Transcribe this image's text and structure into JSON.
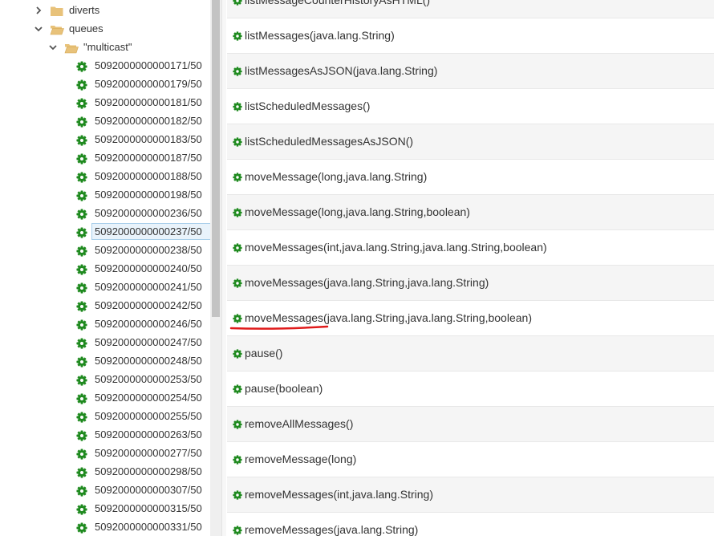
{
  "tree": {
    "folders": [
      {
        "label": "diverts",
        "expanded": false
      },
      {
        "label": "queues",
        "expanded": true
      },
      {
        "label": "\"multicast\"",
        "expanded": true
      }
    ],
    "queue_items": [
      "5092000000000171/50",
      "5092000000000179/50",
      "5092000000000181/50",
      "5092000000000182/50",
      "5092000000000183/50",
      "5092000000000187/50",
      "5092000000000188/50",
      "5092000000000198/50",
      "5092000000000236/50",
      "5092000000000237/50",
      "5092000000000238/50",
      "5092000000000240/50",
      "5092000000000241/50",
      "5092000000000242/50",
      "5092000000000246/50",
      "5092000000000247/50",
      "5092000000000248/50",
      "5092000000000253/50",
      "5092000000000254/50",
      "5092000000000255/50",
      "5092000000000263/50",
      "5092000000000277/50",
      "5092000000000298/50",
      "5092000000000307/50",
      "5092000000000315/50",
      "5092000000000331/50"
    ],
    "selected_item": "5092000000000237/50"
  },
  "operations": [
    "listMessageCounterHistoryAsHTML()",
    "listMessages(java.lang.String)",
    "listMessagesAsJSON(java.lang.String)",
    "listScheduledMessages()",
    "listScheduledMessagesAsJSON()",
    "moveMessage(long,java.lang.String)",
    "moveMessage(long,java.lang.String,boolean)",
    "moveMessages(int,java.lang.String,java.lang.String,boolean)",
    "moveMessages(java.lang.String,java.lang.String)",
    "moveMessages(java.lang.String,java.lang.String,boolean)",
    "pause()",
    "pause(boolean)",
    "removeAllMessages()",
    "removeMessage(long)",
    "removeMessages(int,java.lang.String)",
    "removeMessages(java.lang.String)"
  ],
  "highlighted_operation": "moveMessages(java.lang.String,java.lang.String,boolean)",
  "colors": {
    "gear": "#1f8a1f",
    "folder": "#e8c27a",
    "underline": "#e01b1b",
    "selected_bg": "#e9f3fb",
    "selected_border": "#a9cfea"
  },
  "icons": {
    "tree_item": "gear-icon",
    "folder": "folder-icon",
    "expanded": "chevron-down-icon",
    "collapsed": "chevron-right-icon"
  }
}
